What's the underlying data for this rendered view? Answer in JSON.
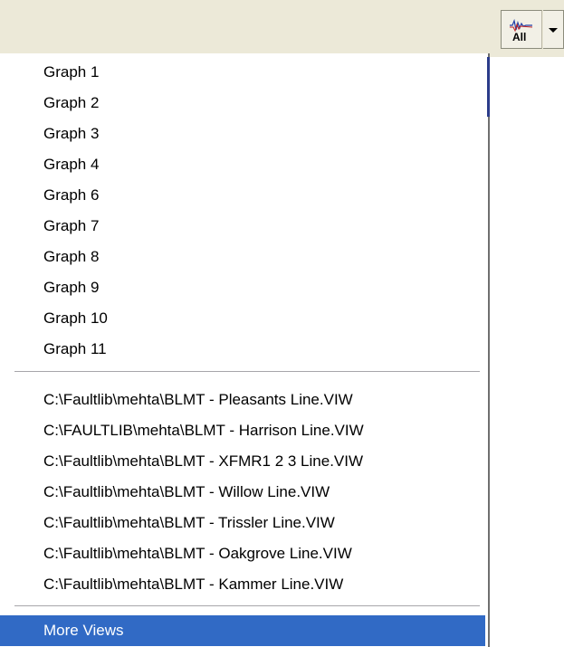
{
  "toolbar": {
    "button_icon": "waveform-all-icon",
    "button_icon_text": "All",
    "dropdown_icon": "chevron-down-icon"
  },
  "menu": {
    "graphs": [
      "Graph 1",
      "Graph 2",
      "Graph 3",
      "Graph 4",
      "Graph 6",
      "Graph 7",
      "Graph 8",
      "Graph 9",
      "Graph 10",
      "Graph 11"
    ],
    "views": [
      "C:\\Faultlib\\mehta\\BLMT - Pleasants Line.VIW",
      "C:\\FAULTLIB\\mehta\\BLMT - Harrison Line.VIW",
      "C:\\Faultlib\\mehta\\BLMT - XFMR1 2 3 Line.VIW",
      "C:\\Faultlib\\mehta\\BLMT - Willow Line.VIW",
      "C:\\Faultlib\\mehta\\BLMT - Trissler Line.VIW",
      "C:\\Faultlib\\mehta\\BLMT - Oakgrove Line.VIW",
      "C:\\Faultlib\\mehta\\BLMT - Kammer Line.VIW"
    ],
    "more_views": "More Views"
  },
  "colors": {
    "selection": "#316ac5",
    "toolbar_bg": "#ece9d8"
  }
}
